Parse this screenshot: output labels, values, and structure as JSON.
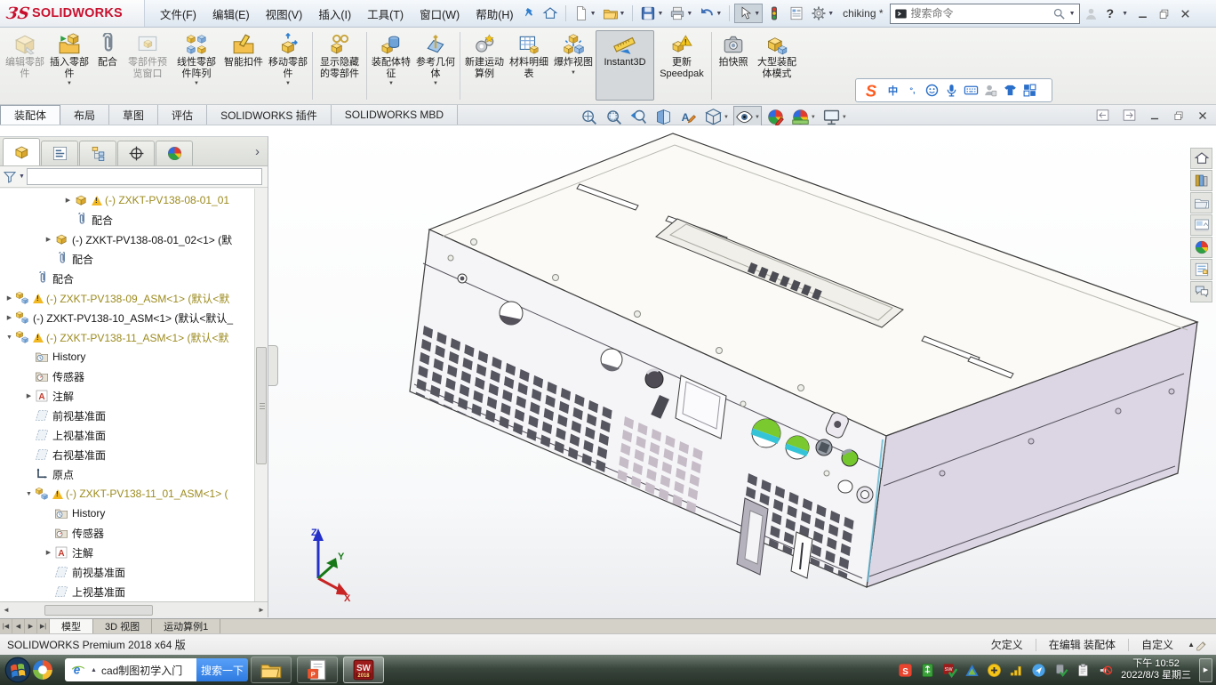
{
  "colors": {
    "brand_red": "#c8102e",
    "tree_warning_text": "#9c8b1f",
    "taskbar_search_button": "#2e7ae0",
    "model_right_face": "#dcd6e4"
  },
  "titlebar": {
    "logo_mark": "ЗS",
    "brand": "SOLIDWORKS",
    "menus": [
      "文件(F)",
      "编辑(E)",
      "视图(V)",
      "插入(I)",
      "工具(T)",
      "窗口(W)",
      "帮助(H)"
    ],
    "quick_icons": [
      {
        "icon": "home"
      },
      {
        "sep": true
      },
      {
        "icon": "new-document",
        "dropdown": true
      },
      {
        "icon": "open",
        "dropdown": true
      },
      {
        "sep": true
      },
      {
        "icon": "save",
        "dropdown": true
      },
      {
        "icon": "print",
        "dropdown": true
      },
      {
        "icon": "undo",
        "dropdown": true
      },
      {
        "sep": true
      },
      {
        "icon": "select-cursor",
        "dropdown": true,
        "pressed": true
      },
      {
        "icon": "rebuild"
      },
      {
        "icon": "display-settings"
      },
      {
        "icon": "options",
        "dropdown": true
      }
    ],
    "username": "chiking *",
    "search_placeholder": "搜索命令",
    "help_label": "?"
  },
  "ribbon": {
    "buttons": [
      {
        "label": "编辑零部件",
        "icon": "edit-component",
        "disabled": true
      },
      {
        "label": "插入零部件",
        "icon": "insert-component",
        "dropdown": true
      },
      {
        "label": "配合",
        "icon": "mate"
      },
      {
        "label": "零部件预览窗口",
        "icon": "component-preview",
        "disabled": true
      },
      {
        "label": "线性零部件阵列",
        "icon": "linear-pattern",
        "dropdown": true
      },
      {
        "label": "智能扣件",
        "icon": "smart-fasteners"
      },
      {
        "label": "移动零部件",
        "icon": "move-component",
        "dropdown": true
      },
      {
        "label": "显示隐藏的零部件",
        "icon": "show-hidden"
      },
      {
        "label": "装配体特征",
        "icon": "assembly-features",
        "dropdown": true
      },
      {
        "label": "参考几何体",
        "icon": "reference-geometry",
        "dropdown": true
      },
      {
        "label": "新建运动算例",
        "icon": "motion-study"
      },
      {
        "label": "材料明细表",
        "icon": "bom"
      },
      {
        "label": "爆炸视图",
        "icon": "exploded-view",
        "dropdown": true
      },
      {
        "label": "Instant3D",
        "icon": "instant3d",
        "active": true
      },
      {
        "label": "更新 Speedpak",
        "icon": "update-speedpak"
      },
      {
        "label": "拍快照",
        "icon": "snapshot"
      },
      {
        "label": "大型装配体模式",
        "icon": "large-assembly"
      }
    ],
    "separators_after": [
      6,
      7,
      9,
      14
    ]
  },
  "ime_toolbar": {
    "icons": [
      "sogou-logo",
      "chinese-mode",
      "punctuation",
      "emoji",
      "microphone",
      "soft-keyboard",
      "account",
      "skin",
      "toolbox"
    ]
  },
  "doc_tabs": {
    "active": "装配体",
    "items": [
      "装配体",
      "布局",
      "草图",
      "评估",
      "SOLIDWORKS 插件",
      "SOLIDWORKS MBD"
    ]
  },
  "headsup": [
    {
      "icon": "zoom-fit"
    },
    {
      "icon": "zoom-area"
    },
    {
      "icon": "previous-view"
    },
    {
      "icon": "section-view"
    },
    {
      "icon": "annotation-view"
    },
    {
      "icon": "view-orientation",
      "dropdown": true
    },
    {
      "icon": "hide-show-items",
      "dropdown": true,
      "pressed": true
    },
    {
      "icon": "edit-appearance"
    },
    {
      "icon": "apply-scene",
      "dropdown": true
    },
    {
      "icon": "view-settings",
      "dropdown": true
    }
  ],
  "feature_panel": {
    "tabs": [
      {
        "icon": "featuremanager",
        "active": true
      },
      {
        "icon": "propertymanager"
      },
      {
        "icon": "configurationmanager"
      },
      {
        "icon": "dimxpertmanager"
      },
      {
        "icon": "displaymanager"
      }
    ],
    "filter_value": ""
  },
  "tree": {
    "items": [
      {
        "level": 3,
        "arrow": "collapsed",
        "icon": "part",
        "warning": true,
        "text": "(-) ZXKT-PV138-08-01_01",
        "style": "warn"
      },
      {
        "level": 3,
        "icon": "mates",
        "text": "配合"
      },
      {
        "level": 2,
        "arrow": "collapsed",
        "icon": "part",
        "text": "(-) ZXKT-PV138-08-01_02<1> (默"
      },
      {
        "level": 2,
        "icon": "mates",
        "text": "配合"
      },
      {
        "level": 1,
        "icon": "mates",
        "text": "配合"
      },
      {
        "level": 0,
        "arrow": "collapsed",
        "icon": "assembly",
        "warning": true,
        "text": "(-) ZXKT-PV138-09_ASM<1> (默认<默",
        "style": "warn"
      },
      {
        "level": 0,
        "arrow": "collapsed",
        "icon": "assembly",
        "text": "(-) ZXKT-PV138-10_ASM<1> (默认<默认_"
      },
      {
        "level": 0,
        "arrow": "expanded",
        "icon": "assembly",
        "warning": true,
        "text": "(-) ZXKT-PV138-11_ASM<1> (默认<默",
        "style": "warn"
      },
      {
        "level": 1,
        "icon": "history",
        "text": "History"
      },
      {
        "level": 1,
        "icon": "sensors",
        "text": "传感器"
      },
      {
        "level": 1,
        "arrow": "collapsed",
        "icon": "annotations",
        "text": "注解"
      },
      {
        "level": 1,
        "icon": "plane",
        "text": "前视基准面"
      },
      {
        "level": 1,
        "icon": "plane",
        "text": "上视基准面"
      },
      {
        "level": 1,
        "icon": "plane",
        "text": "右视基准面"
      },
      {
        "level": 1,
        "icon": "origin",
        "text": "原点"
      },
      {
        "level": 1,
        "arrow": "expanded",
        "icon": "assembly",
        "warning": true,
        "text": "(-) ZXKT-PV138-11_01_ASM<1> (",
        "style": "warn"
      },
      {
        "level": 2,
        "icon": "history",
        "text": "History"
      },
      {
        "level": 2,
        "icon": "sensors",
        "text": "传感器"
      },
      {
        "level": 2,
        "arrow": "collapsed",
        "icon": "annotations",
        "text": "注解"
      },
      {
        "level": 2,
        "icon": "plane",
        "text": "前视基准面"
      },
      {
        "level": 2,
        "icon": "plane",
        "text": "上视基准面"
      }
    ]
  },
  "model_tabs": {
    "active": "模型",
    "items": [
      "模型",
      "3D 视图",
      "运动算例1"
    ]
  },
  "statusbar": {
    "product": "SOLIDWORKS Premium 2018 x64 版",
    "definition_status": "欠定义",
    "edit_status": "在编辑 装配体",
    "custom_label": "自定义"
  },
  "taskpane_right": [
    "home",
    "design-library",
    "file-explorer",
    "view-palette",
    "appearances",
    "custom-properties",
    "forum"
  ],
  "taskbar": {
    "search_query": "cad制图初学入门",
    "search_button_label": "搜索一下",
    "apps": [
      {
        "icon": "explorer"
      },
      {
        "icon": "wps-doc"
      },
      {
        "icon": "solidworks-2018",
        "active": true
      }
    ],
    "tray": [
      "sogou",
      "usb",
      "sw-ok",
      "green-triangle",
      "plus",
      "signal",
      "nav",
      "usb-ok",
      "clipboard",
      "volume-muted"
    ],
    "clock_time": "下午 10:52",
    "clock_date": "2022/8/3 星期三"
  },
  "viewport": {
    "triad": {
      "x_label": "X",
      "y_label": "Y",
      "z_label": "Z"
    }
  }
}
